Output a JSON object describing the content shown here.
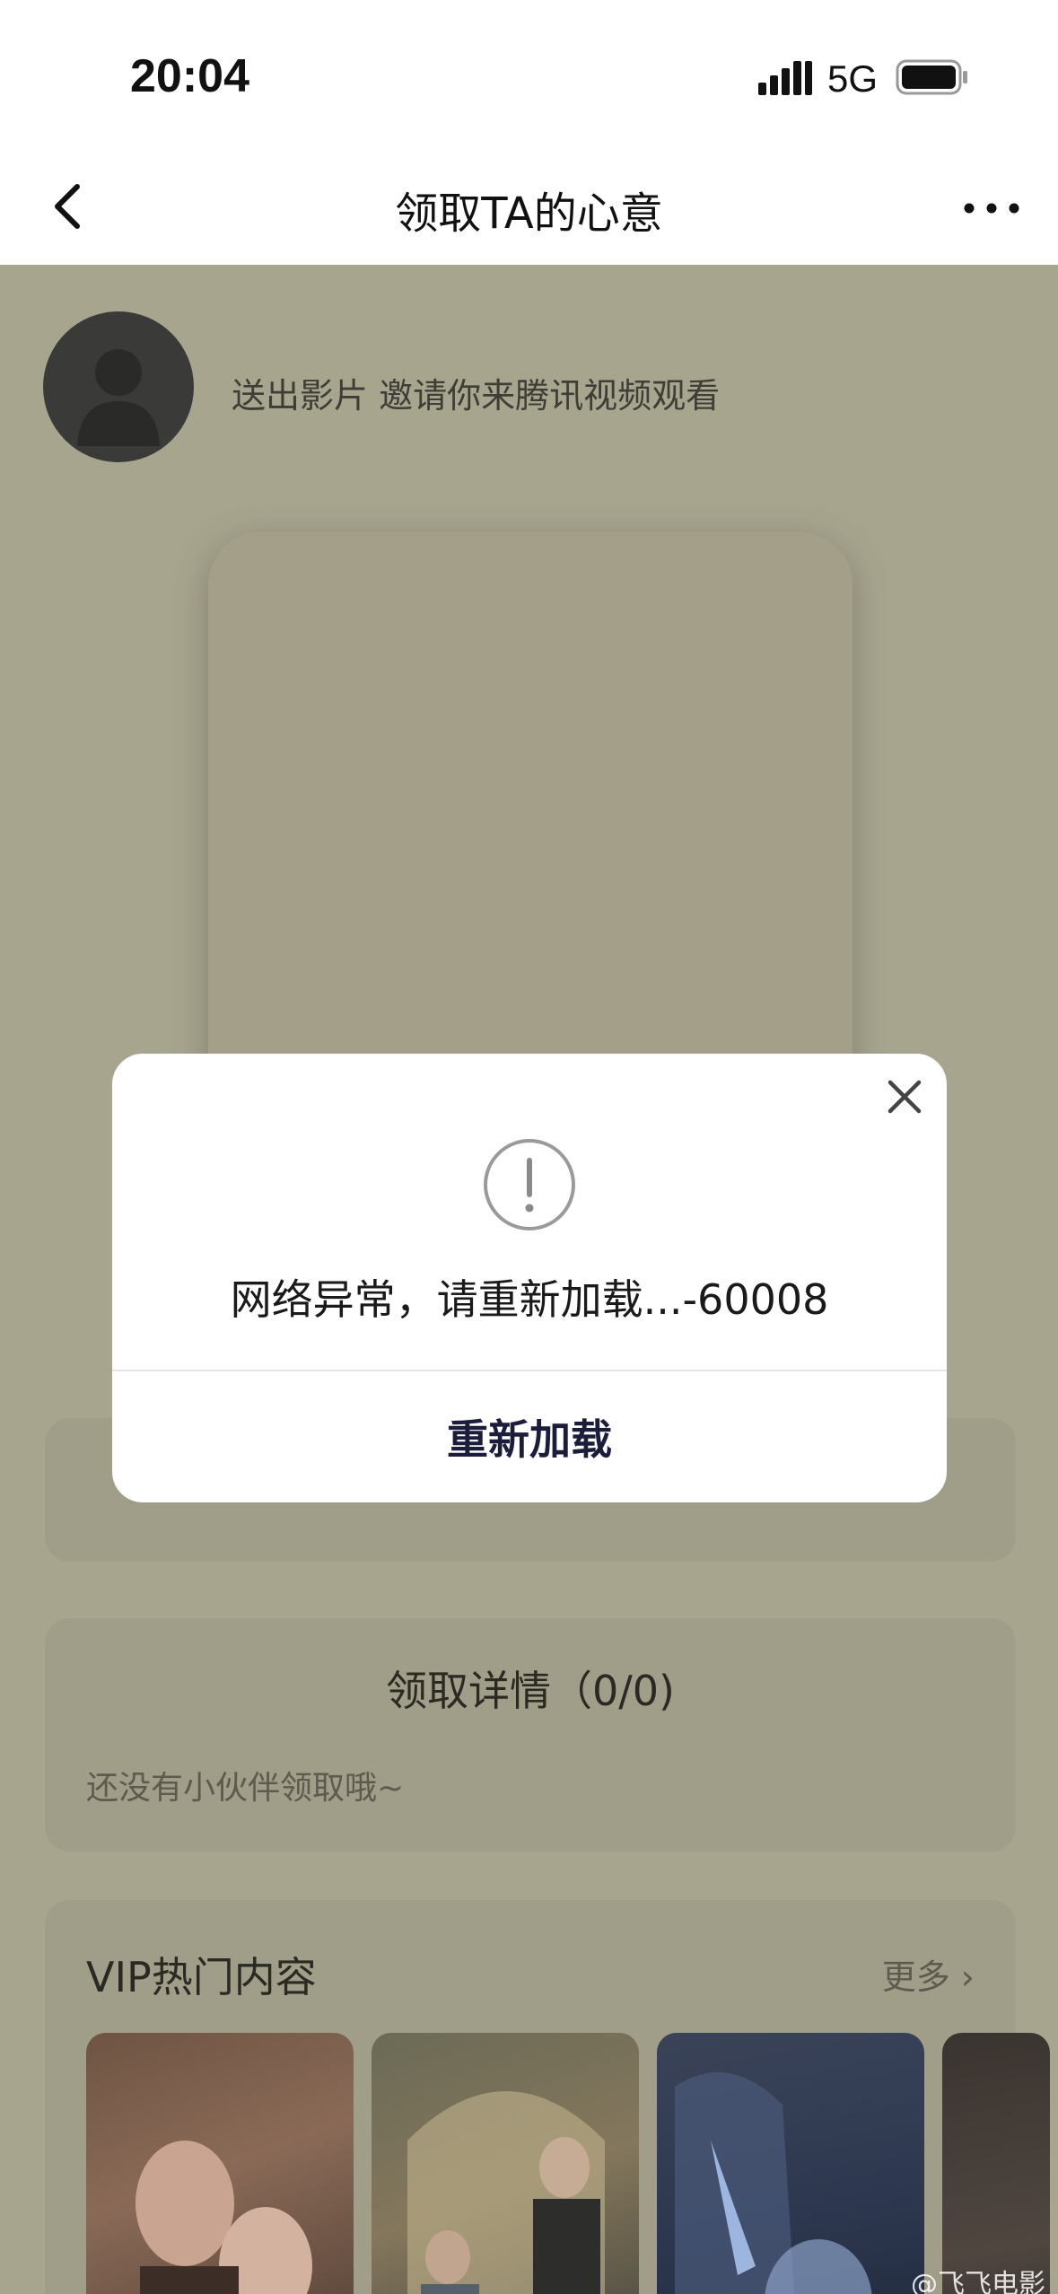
{
  "status_bar": {
    "time": "20:04",
    "network": "5G",
    "icons": [
      "signal-icon",
      "battery-icon"
    ]
  },
  "nav": {
    "title": "领取TA的心意",
    "back_icon": "chevron-left-icon",
    "more_icon": "more-horizontal-icon"
  },
  "sender": {
    "text": "送出影片 邀请你来腾讯视频观看"
  },
  "claim_details": {
    "title": "领取详情（0/0)",
    "empty_text": "还没有小伙伴领取哦~"
  },
  "vip_section": {
    "title": "VIP热门内容",
    "more_label": "更多 ›"
  },
  "dialog": {
    "message": "网络异常，请重新加载...-60008",
    "reload_label": "重新加载",
    "icons": [
      "alert-circle-icon",
      "close-icon"
    ]
  },
  "watermark": {
    "text": "@飞飞电影"
  }
}
